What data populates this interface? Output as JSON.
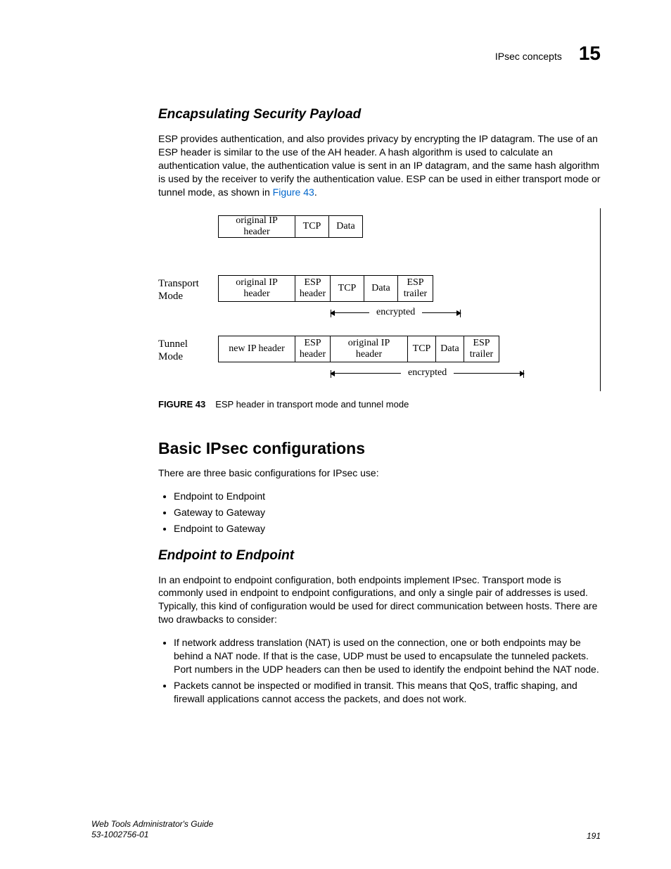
{
  "header": {
    "topic": "IPsec concepts",
    "chapter": "15"
  },
  "s1": {
    "title": "Encapsulating Security Payload",
    "p_a": "ESP provides authentication, and also provides privacy by encrypting the IP datagram. The use of an ESP header is similar to the use of the AH header. A hash algorithm is used to calculate an authentication value, the authentication value is sent in an IP datagram, and the same hash algorithm is used by the receiver to verify the authentication value. ESP can be used in either transport mode or tunnel mode, as shown in ",
    "figlink": "Figure 43",
    "p_b": "."
  },
  "fig": {
    "row1": [
      "original IP header",
      "TCP",
      "Data"
    ],
    "label_t": "Transport\nMode",
    "row2": [
      "original IP header",
      "ESP\nheader",
      "TCP",
      "Data",
      "ESP\ntrailer"
    ],
    "enc2": "encrypted",
    "label_u": "Tunnel\nMode",
    "row3": [
      "new IP header",
      "ESP\nheader",
      "original IP header",
      "TCP",
      "Data",
      "ESP\ntrailer"
    ],
    "enc3": "encrypted",
    "cap_lbl": "FIGURE 43",
    "cap_txt": "ESP header in transport mode and tunnel mode"
  },
  "s2": {
    "title": "Basic IPsec configurations",
    "intro": "There are three basic configurations for IPsec use:",
    "items": {
      "i0": "Endpoint to Endpoint",
      "i1": "Gateway to Gateway",
      "i2": "Endpoint to Gateway"
    }
  },
  "s3": {
    "title": "Endpoint to Endpoint",
    "p": "In an endpoint to endpoint configuration, both endpoints implement IPsec. Transport mode is commonly used in endpoint to endpoint configurations, and only a single pair of addresses is used. Typically, this kind of configuration would be used for direct communication between hosts. There are two drawbacks to consider:",
    "b0": "If network address translation (NAT) is used on the connection, one or both endpoints may be behind a NAT node. If that is the case, UDP must be used to encapsulate the tunneled packets. Port numbers in the UDP headers can then be used to identify the endpoint behind the NAT node.",
    "b1": "Packets cannot be inspected or modified in transit. This means that QoS, traffic shaping, and firewall applications cannot access the packets, and does not work."
  },
  "footer": {
    "book": "Web Tools Administrator's Guide",
    "doc": "53-1002756-01",
    "page": "191"
  }
}
